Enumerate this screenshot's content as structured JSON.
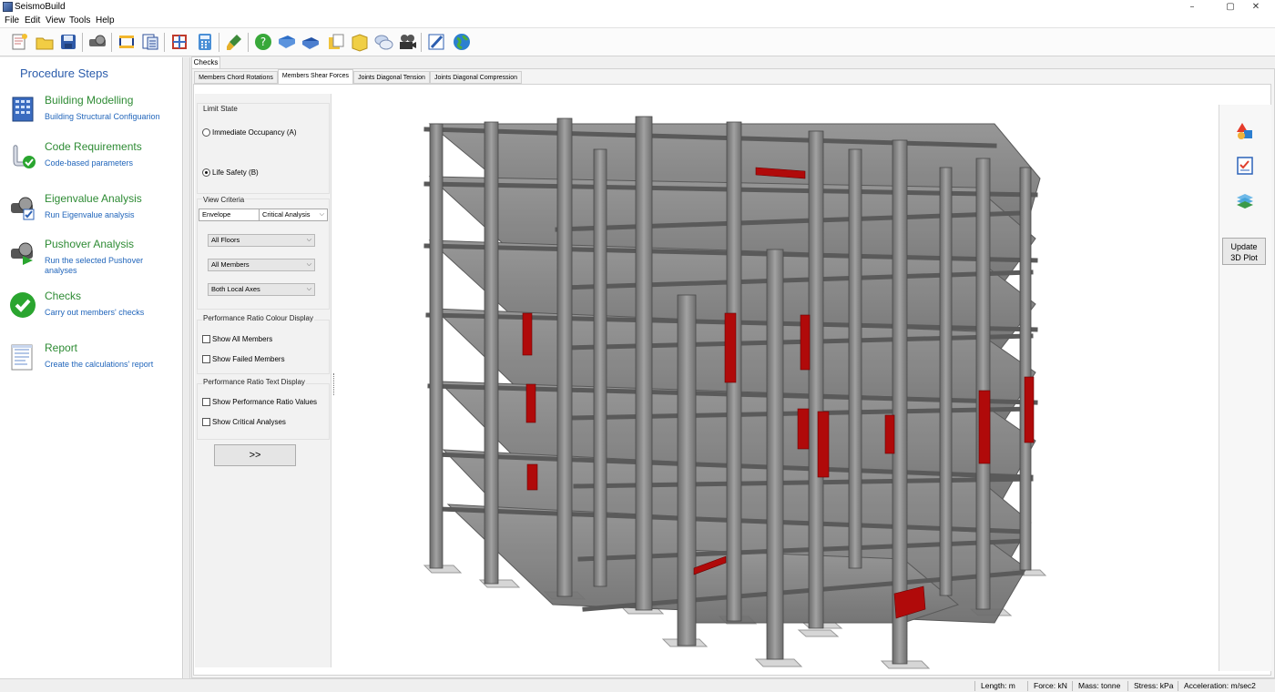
{
  "window": {
    "title": "SeismoBuild",
    "controls": [
      "–",
      "▢",
      "✕"
    ]
  },
  "menu": [
    "File",
    "Edit",
    "View",
    "Tools",
    "Help"
  ],
  "toolbar": {
    "icons": [
      "new-project-icon",
      "open-folder-icon",
      "save-icon",
      "settings-icon",
      "building-icon",
      "import-icon",
      "fence-icon",
      "calculator-icon",
      "brush-icon",
      "help-icon",
      "manual-icon",
      "book-icon",
      "notes-icon",
      "folder-icon",
      "chat-icon",
      "film-icon",
      "edit-icon",
      "globe-icon"
    ]
  },
  "sidebar": {
    "heading": "Procedure Steps",
    "steps": [
      {
        "title": "Building Modelling",
        "subtitle": "Building Structural Configuarion",
        "icon": "building-icon"
      },
      {
        "title": "Code Requirements",
        "subtitle": "Code-based parameters",
        "icon": "scroll-check-icon"
      },
      {
        "title": "Eigenvalue Analysis",
        "subtitle": "Run Eigenvalue analysis",
        "icon": "eigen-analysis-icon"
      },
      {
        "title": "Pushover Analysis",
        "subtitle": "Run the selected Pushover analyses",
        "icon": "pushover-analysis-icon"
      },
      {
        "title": "Checks",
        "subtitle": "Carry out members' checks",
        "icon": "green-check-icon"
      },
      {
        "title": "Report",
        "subtitle": "Create the calculations' report",
        "icon": "report-icon"
      }
    ]
  },
  "main": {
    "top_tab": "Checks",
    "sub_tabs": [
      "Members Chord Rotations",
      "Members Shear Forces",
      "Joints Diagonal Tension",
      "Joints Diagonal Compression"
    ],
    "active_sub_tab": "Members Shear Forces"
  },
  "criteria": {
    "limit_state_label": "Limit State",
    "limit_states": [
      {
        "label": "Immediate Occupancy (A)",
        "selected": false
      },
      {
        "label": "Life Safety (B)",
        "selected": true
      }
    ],
    "view_criteria_label": "View Criteria",
    "envelope_value": "Envelope",
    "analysis_value": "Critical Analysis",
    "floors_value": "All Floors",
    "members_value": "All Members",
    "axes_value": "Both Local Axes",
    "ratio_colour_label": "Performance Ratio Colour Display",
    "show_all_members": "Show All Members",
    "show_failed_members": "Show Failed Members",
    "ratio_text_label": "Performance Ratio Text Display",
    "show_ratio_values": "Show Performance Ratio Values",
    "show_critical_analyses": "Show Critical Analyses",
    "go_button": ">>"
  },
  "right_panel": {
    "icons": [
      "shapes-icon",
      "checklist-icon",
      "layers-icon"
    ],
    "update_button_line1": "Update",
    "update_button_line2": "3D Plot"
  },
  "status": {
    "length": "Length: m",
    "force": "Force: kN",
    "mass": "Mass: tonne",
    "stress": "Stress: kPa",
    "acceleration": "Acceleration: m/sec2"
  },
  "colors": {
    "member": "#8c8c8c",
    "member_dark": "#5f5f5f",
    "failed_member": "#b00a0a",
    "accent": "#2b5cab",
    "step_title": "#2e8b34"
  }
}
